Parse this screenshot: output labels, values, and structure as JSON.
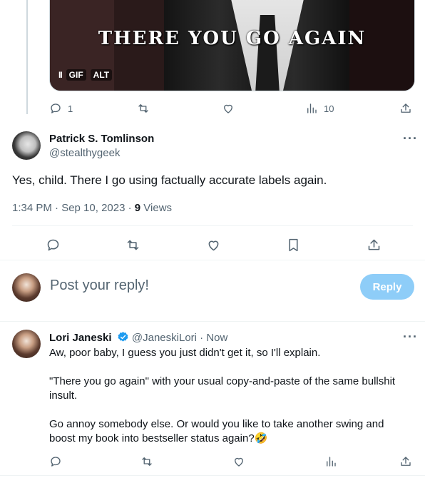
{
  "media": {
    "caption": "THERE YOU GO AGAIN",
    "pause_label": "II",
    "gif_label": "GIF",
    "alt_label": "ALT"
  },
  "parent_actions": {
    "reply_count": "1",
    "retweet_count": "",
    "like_count": "",
    "views_count": "10"
  },
  "main_post": {
    "author_name": "Patrick S. Tomlinson",
    "author_handle": "@stealthygeek",
    "text": "Yes, child. There I go using factually accurate labels again.",
    "timestamp": "1:34 PM · Sep 10, 2023 · ",
    "views_number": "9",
    "views_label": " Views",
    "more_label": "···"
  },
  "composer": {
    "placeholder": "Post your reply!",
    "reply_button": "Reply"
  },
  "reply_post": {
    "author_name": "Lori Janeski",
    "author_handle": "@JaneskiLori",
    "time": " · Now",
    "more_label": "···",
    "paragraphs": [
      "Aw, poor baby, I guess you just didn't get it, so I'll explain.",
      "\"There you go again\" with your usual copy-and-paste of the same bullshit insult.",
      "Go annoy somebody else. Or would you like to take another swing and boost my book into bestseller status again?🤣"
    ]
  },
  "colors": {
    "accent": "#1d9bf0",
    "reply_button_disabled": "#8ecdf8",
    "secondary_text": "#536471",
    "divider": "#eff3f4"
  },
  "icons": [
    "reply-icon",
    "retweet-icon",
    "like-icon",
    "views-icon",
    "share-icon",
    "bookmark-icon",
    "verified-icon"
  ]
}
